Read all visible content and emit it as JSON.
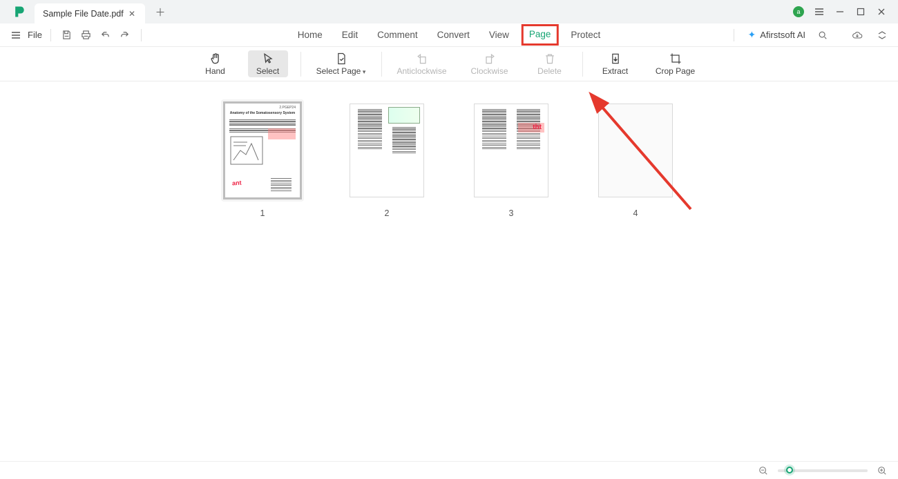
{
  "titlebar": {
    "tab_title": "Sample File Date.pdf",
    "avatar_letter": "a"
  },
  "menubar": {
    "file_label": "File",
    "items": [
      "Home",
      "Edit",
      "Comment",
      "Convert",
      "View",
      "Page",
      "Protect"
    ],
    "active_index": 5,
    "boxed_index": 5,
    "ai_label": "Afirstsoft AI"
  },
  "ribbon": {
    "tools": [
      {
        "id": "hand",
        "label": "Hand",
        "icon": "hand",
        "active": false,
        "disabled": false,
        "interactable": true
      },
      {
        "id": "select",
        "label": "Select",
        "icon": "cursor",
        "active": true,
        "disabled": false,
        "interactable": true
      },
      {
        "sep": true
      },
      {
        "id": "select-page",
        "label": "Select Page",
        "icon": "page-check",
        "dropdown": true,
        "interactable": true
      },
      {
        "sep": true
      },
      {
        "id": "anticlockwise",
        "label": "Anticlockwise",
        "icon": "rotate-left",
        "disabled": true,
        "interactable": true
      },
      {
        "id": "clockwise",
        "label": "Clockwise",
        "icon": "rotate-right",
        "disabled": true,
        "interactable": true
      },
      {
        "id": "delete",
        "label": "Delete",
        "icon": "trash",
        "disabled": true,
        "interactable": true
      },
      {
        "sep": true
      },
      {
        "id": "extract",
        "label": "Extract",
        "icon": "extract",
        "disabled": false,
        "interactable": true
      },
      {
        "id": "crop-page",
        "label": "Crop Page",
        "icon": "crop",
        "disabled": false,
        "interactable": true
      }
    ]
  },
  "pages": {
    "items": [
      {
        "num": "1",
        "selected": true,
        "blank": false,
        "overlay_tools": true,
        "content": {
          "title": "Anatomy of the Somatosensory System",
          "header": "2.PGEP24",
          "highlight_right": true,
          "figure": true,
          "stamp": "ant"
        }
      },
      {
        "num": "2",
        "selected": false,
        "blank": false,
        "content": {
          "two_col": true,
          "diagram_top": true
        }
      },
      {
        "num": "3",
        "selected": false,
        "blank": false,
        "content": {
          "two_col": true,
          "highlight_right": true,
          "overlay_text": "tht"
        }
      },
      {
        "num": "4",
        "selected": false,
        "blank": true
      }
    ]
  },
  "annotations": {
    "red_arrow": true,
    "arrow_target": "extract"
  },
  "status": {
    "zoom_pos_percent": 10
  },
  "icons": {
    "insert-left": "insert-left-icon",
    "insert-right": "insert-right-icon",
    "delete": "delete-icon"
  },
  "colors": {
    "accent": "#17a574",
    "annotation_red": "#e5392d"
  }
}
